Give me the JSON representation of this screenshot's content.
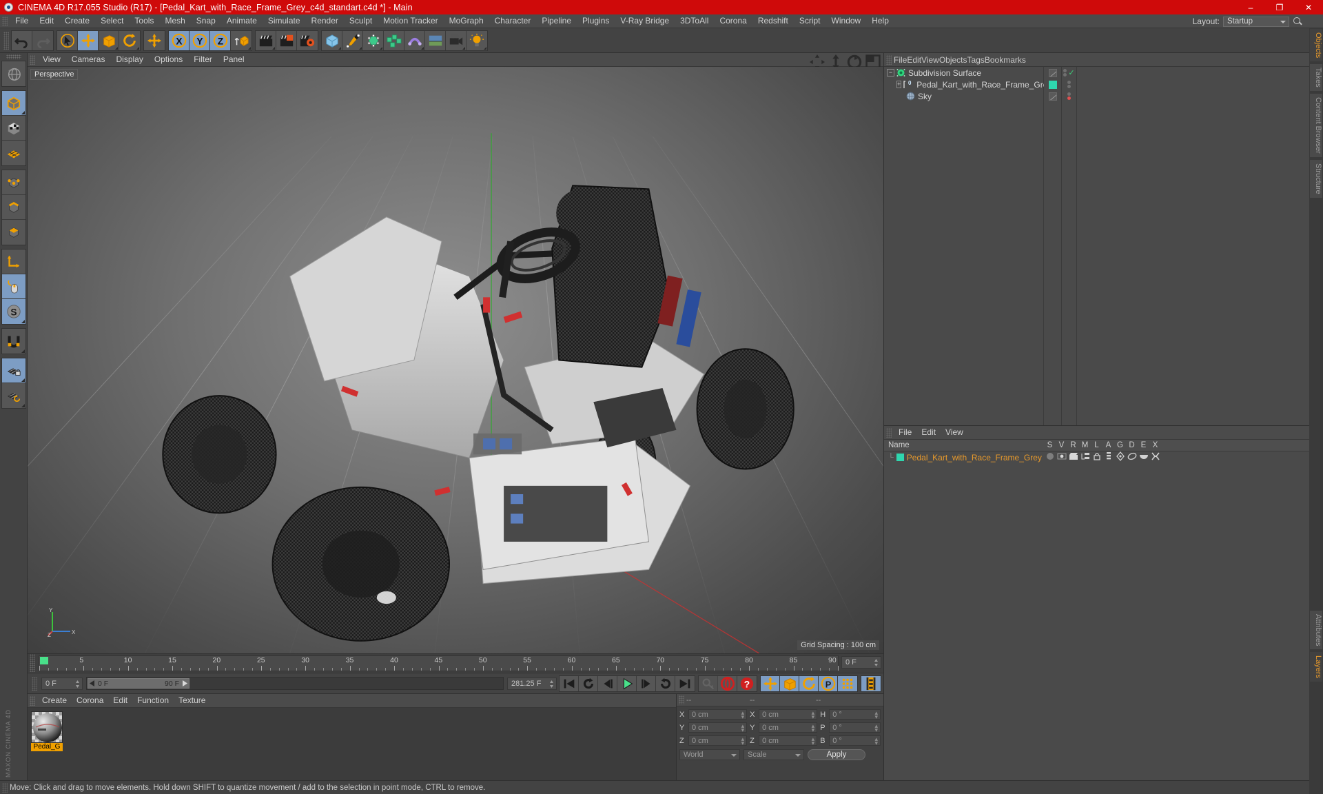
{
  "window": {
    "title": "CINEMA 4D R17.055 Studio (R17) - [Pedal_Kart_with_Race_Frame_Grey_c4d_standart.c4d *] - Main",
    "minimize": "–",
    "maximize": "❐",
    "close": "✕",
    "titlebar_color": "#cf0a0a"
  },
  "menubar": {
    "items": [
      {
        "label": "File"
      },
      {
        "label": "Edit"
      },
      {
        "label": "Create"
      },
      {
        "label": "Select"
      },
      {
        "label": "Tools"
      },
      {
        "label": "Mesh"
      },
      {
        "label": "Snap"
      },
      {
        "label": "Animate"
      },
      {
        "label": "Simulate"
      },
      {
        "label": "Render"
      },
      {
        "label": "Sculpt"
      },
      {
        "label": "Motion Tracker"
      },
      {
        "label": "MoGraph"
      },
      {
        "label": "Character"
      },
      {
        "label": "Pipeline"
      },
      {
        "label": "Plugins"
      },
      {
        "label": "V-Ray Bridge"
      },
      {
        "label": "3DToAll"
      },
      {
        "label": "Corona"
      },
      {
        "label": "Redshift"
      },
      {
        "label": "Script"
      },
      {
        "label": "Window"
      },
      {
        "label": "Help"
      }
    ],
    "layout_label": "Layout:",
    "layout_value": "Startup"
  },
  "toolbar": {
    "groups": [
      {
        "name": "history",
        "buttons": [
          {
            "name": "undo-button",
            "icon": "undo-icon",
            "state": "normal"
          },
          {
            "name": "redo-button",
            "icon": "redo-icon",
            "state": "disabled"
          }
        ]
      },
      {
        "name": "transform-tools",
        "buttons": [
          {
            "name": "select-tool-button",
            "icon": "cursor-select-icon",
            "state": "normal"
          },
          {
            "name": "move-tool-button",
            "icon": "move-arrows-icon",
            "state": "active"
          },
          {
            "name": "scale-tool-button",
            "icon": "scale-box-icon",
            "state": "normal"
          },
          {
            "name": "rotate-tool-button",
            "icon": "rotate-circle-icon",
            "state": "normal"
          }
        ]
      },
      {
        "name": "drag-tool",
        "buttons": [
          {
            "name": "drag-tool-button",
            "icon": "move-arrows-icon",
            "state": "normal"
          }
        ]
      },
      {
        "name": "axis-locks",
        "buttons": [
          {
            "name": "lock-x-axis-button",
            "icon": "axis-x-icon",
            "state": "active"
          },
          {
            "name": "lock-y-axis-button",
            "icon": "axis-y-icon",
            "state": "active"
          },
          {
            "name": "lock-z-axis-button",
            "icon": "axis-z-icon",
            "state": "active"
          },
          {
            "name": "world-object-coords-button",
            "icon": "world-cube-icon",
            "state": "normal"
          }
        ]
      },
      {
        "name": "render-tools",
        "buttons": [
          {
            "name": "render-view-button",
            "icon": "clapper-icon",
            "state": "normal"
          },
          {
            "name": "render-to-picture-viewer-button",
            "icon": "clapper-picture-icon",
            "state": "normal"
          },
          {
            "name": "render-settings-button",
            "icon": "clapper-gear-icon",
            "state": "normal"
          }
        ]
      },
      {
        "name": "create-objects",
        "buttons": [
          {
            "name": "add-cube-button",
            "icon": "blue-cube-icon",
            "state": "normal"
          },
          {
            "name": "add-spline-button",
            "icon": "pen-spline-icon",
            "state": "normal"
          },
          {
            "name": "add-nurbs-button",
            "icon": "green-nurbs-icon",
            "state": "normal"
          },
          {
            "name": "add-modeling-object-button",
            "icon": "green-array-icon",
            "state": "normal"
          },
          {
            "name": "add-deformer-button",
            "icon": "purple-deformer-icon",
            "state": "normal"
          },
          {
            "name": "add-environment-button",
            "icon": "floor-sky-icon",
            "state": "normal"
          },
          {
            "name": "add-camera-button",
            "icon": "camera-icon",
            "state": "normal"
          },
          {
            "name": "add-light-button",
            "icon": "light-bulb-icon",
            "state": "normal"
          }
        ]
      }
    ]
  },
  "left_toolbar": {
    "buttons": [
      {
        "name": "viewport-navigation-button",
        "icon": "globe-navigate-icon",
        "state": "normal"
      },
      {
        "name": "model-mode-button",
        "icon": "model-cube-icon",
        "state": "active"
      },
      {
        "name": "texture-mode-button",
        "icon": "texture-checker-cube-icon",
        "state": "normal"
      },
      {
        "name": "workplane-mode-button",
        "icon": "workplane-grid-icon",
        "state": "normal"
      },
      {
        "name": "point-mode-button",
        "icon": "points-cube-icon",
        "state": "normal"
      },
      {
        "name": "edge-mode-button",
        "icon": "edge-cube-icon",
        "state": "normal"
      },
      {
        "name": "polygon-mode-button",
        "icon": "polygon-cube-icon",
        "state": "normal"
      },
      {
        "name": "object-axis-mode-button",
        "icon": "axis-corner-icon",
        "state": "normal"
      },
      {
        "name": "viewport-solo-button",
        "icon": "mouse-icon",
        "state": "active"
      },
      {
        "name": "soft-selection-button",
        "icon": "s-compass-icon",
        "state": "active"
      },
      {
        "name": "enable-snapping-button",
        "icon": "magnet-icon",
        "state": "normal"
      },
      {
        "name": "lock-workplane-button",
        "icon": "grid-lock-icon",
        "state": "active"
      },
      {
        "name": "planar-workplane-button",
        "icon": "grid-rotate-icon",
        "state": "normal"
      }
    ],
    "brand": "MAXON CINEMA 4D"
  },
  "viewport": {
    "menu": [
      {
        "label": "View"
      },
      {
        "label": "Cameras"
      },
      {
        "label": "Display"
      },
      {
        "label": "Options"
      },
      {
        "label": "Filter"
      },
      {
        "label": "Panel"
      }
    ],
    "label": "Perspective",
    "grid_spacing": "Grid Spacing : 100 cm",
    "axis_x": "X",
    "axis_y": "Y",
    "axis_z": "Z",
    "corner_icons": [
      {
        "name": "viewport-pan-icon"
      },
      {
        "name": "viewport-dolly-icon"
      },
      {
        "name": "viewport-orbit-icon"
      },
      {
        "name": "viewport-maximize-icon"
      }
    ]
  },
  "timeline": {
    "ticks": [
      "0",
      "5",
      "10",
      "15",
      "20",
      "25",
      "30",
      "35",
      "40",
      "45",
      "50",
      "55",
      "60",
      "65",
      "70",
      "75",
      "80",
      "85",
      "90"
    ],
    "current_frame": "0 F",
    "end_frame_field": "0 F",
    "range_start": "0 F",
    "range_end": "90 F",
    "max_frame": "281.25 F",
    "playhead_frame": 0
  },
  "playbar": {
    "buttons": [
      {
        "name": "go-to-start-button",
        "icon": "skip-start-icon",
        "state": "normal"
      },
      {
        "name": "previous-keyframe-button",
        "icon": "prev-key-icon",
        "state": "normal"
      },
      {
        "name": "step-back-button",
        "icon": "step-back-icon",
        "state": "normal"
      },
      {
        "name": "play-button",
        "icon": "play-icon",
        "state": "normal"
      },
      {
        "name": "step-forward-button",
        "icon": "step-forward-icon",
        "state": "normal"
      },
      {
        "name": "next-keyframe-button",
        "icon": "next-key-icon",
        "state": "normal"
      },
      {
        "name": "go-to-end-button",
        "icon": "skip-end-icon",
        "state": "normal"
      }
    ],
    "record_group": [
      {
        "name": "autokey-button",
        "icon": "key-icon",
        "state": "disabled"
      },
      {
        "name": "record-active-objects-button",
        "icon": "record-circle-icon",
        "state": "normal"
      },
      {
        "name": "autokeying-button",
        "icon": "autokey-question-icon",
        "state": "normal"
      }
    ],
    "param_group": [
      {
        "name": "record-position-button",
        "icon": "position-arrows-icon",
        "state": "active"
      },
      {
        "name": "record-scale-button",
        "icon": "scale-box-icon",
        "state": "active"
      },
      {
        "name": "record-rotation-button",
        "icon": "rotate-circle-icon",
        "state": "active"
      },
      {
        "name": "record-pla-button",
        "icon": "p-circle-icon",
        "state": "active"
      },
      {
        "name": "record-points-button",
        "icon": "point-grid-icon",
        "state": "active"
      }
    ],
    "extra_group": [
      {
        "name": "keyframe-selection-button",
        "icon": "filmstrip-icon",
        "state": "active"
      }
    ]
  },
  "material_manager": {
    "menu": [
      {
        "label": "Create"
      },
      {
        "label": "Corona"
      },
      {
        "label": "Edit"
      },
      {
        "label": "Function"
      },
      {
        "label": "Texture"
      }
    ],
    "materials": [
      {
        "name": "Pedal_G"
      }
    ]
  },
  "coordinates": {
    "headers": [
      "--",
      "--",
      "--"
    ],
    "rows": [
      {
        "label_pos": "X",
        "value_pos": "0 cm",
        "label_size": "X",
        "value_size": "0 cm",
        "label_rot": "H",
        "value_rot": "0 °"
      },
      {
        "label_pos": "Y",
        "value_pos": "0 cm",
        "label_size": "Y",
        "value_size": "0 cm",
        "label_rot": "P",
        "value_rot": "0 °"
      },
      {
        "label_pos": "Z",
        "value_pos": "0 cm",
        "label_size": "Z",
        "value_size": "0 cm",
        "label_rot": "B",
        "value_rot": "0 °"
      }
    ],
    "coord_system": "World",
    "size_mode": "Scale",
    "apply_label": "Apply"
  },
  "object_manager": {
    "menu": [
      {
        "label": "File"
      },
      {
        "label": "Edit"
      },
      {
        "label": "View"
      },
      {
        "label": "Objects"
      },
      {
        "label": "Tags"
      },
      {
        "label": "Bookmarks"
      }
    ],
    "items": [
      {
        "name": "Subdivision Surface",
        "icon": "subdivision-surface-icon",
        "depth": 0,
        "expander": "−",
        "tag_color": "none",
        "visible_dot": "green-check",
        "selected": false
      },
      {
        "name": "Pedal_Kart_with_Race_Frame_Grey",
        "icon": "polygon-object-icon",
        "depth": 1,
        "expander": "+",
        "tag_color": "#2fd6ae",
        "visible_dot": "none",
        "selected": false,
        "badge": "0"
      },
      {
        "name": "Sky",
        "icon": "sky-sphere-icon",
        "depth": 1,
        "expander": "",
        "tag_color": "none",
        "visible_dot": "red-dot",
        "selected": false
      }
    ],
    "tabs": [
      {
        "label": "Objects",
        "active": true
      },
      {
        "label": "Takes",
        "active": false
      },
      {
        "label": "Content Browser",
        "active": false
      },
      {
        "label": "Structure",
        "active": false
      }
    ]
  },
  "material_list_panel": {
    "menu": [
      {
        "label": "File"
      },
      {
        "label": "Edit"
      },
      {
        "label": "View"
      }
    ],
    "columns": [
      "Name",
      "S",
      "V",
      "R",
      "M",
      "L",
      "A",
      "G",
      "D",
      "E",
      "X"
    ],
    "rows": [
      {
        "name": "Pedal_Kart_with_Race_Frame_Grey",
        "swatch": "#2fd6ae",
        "icons": [
          "solo-dot-icon",
          "visible-eye-icon",
          "render-clapper-icon",
          "multi-layer-icon",
          "unlock-icon",
          "animation-icon",
          "generator-icon",
          "deformer-icon",
          "expression-icon",
          "xref-icon"
        ]
      }
    ],
    "tabs": [
      {
        "label": "Attributes",
        "active": false
      },
      {
        "label": "Layers",
        "active": true
      }
    ]
  },
  "statusbar": {
    "message": "Move: Click and drag to move elements. Hold down SHIFT to quantize movement / add to the selection in point mode, CTRL to remove."
  },
  "colors": {
    "accent_orange": "#e89a2c",
    "active_blue": "#7d9dc4",
    "title_red": "#cf0a0a",
    "teal": "#2fd6ae",
    "panel": "#414141"
  }
}
